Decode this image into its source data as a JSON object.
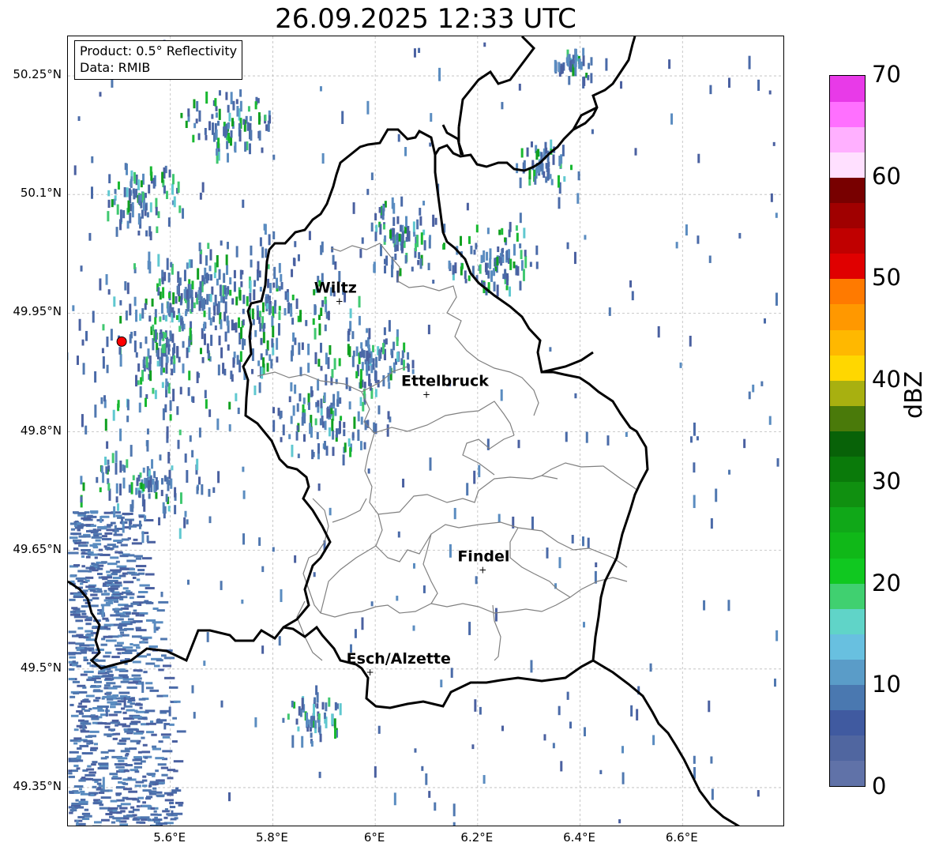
{
  "title": "26.09.2025 12:33 UTC",
  "info": {
    "product": "Product: 0.5° Reflectivity",
    "data": "Data: RMIB"
  },
  "map": {
    "lon_range": [
      5.4,
      6.8
    ],
    "lat_range": [
      49.3,
      50.3
    ],
    "lat_ticks": [
      "50.25°N",
      "50.1°N",
      "49.95°N",
      "49.8°N",
      "49.65°N",
      "49.5°N",
      "49.35°N"
    ],
    "lon_ticks": [
      "5.6°E",
      "5.8°E",
      "6°E",
      "6.2°E",
      "6.4°E",
      "6.6°E"
    ],
    "radar_site": {
      "lon": 5.505,
      "lat": 49.914,
      "color": "#ff0000"
    },
    "cities": [
      {
        "name": "Wiltz",
        "lon": 5.93,
        "lat": 49.966
      },
      {
        "name": "Ettelbruck",
        "lon": 6.1,
        "lat": 49.848
      },
      {
        "name": "Findel",
        "lon": 6.21,
        "lat": 49.626
      },
      {
        "name": "Esch/Alzette",
        "lon": 5.99,
        "lat": 49.497
      }
    ]
  },
  "colorbar": {
    "label": "dBZ",
    "ticks": [
      "70",
      "60",
      "50",
      "40",
      "30",
      "20",
      "10",
      "0"
    ],
    "colors": [
      "#6072a8",
      "#5066a0",
      "#405aa0",
      "#4a78b0",
      "#5a9cc8",
      "#68c0e0",
      "#60d4c8",
      "#40d070",
      "#10c820",
      "#10b818",
      "#10a818",
      "#109010",
      "#0a7a0a",
      "#086208",
      "#4a7a0a",
      "#a8b010",
      "#ffd700",
      "#ffb800",
      "#ff9800",
      "#ff7a00",
      "#e00000",
      "#c00000",
      "#a00000",
      "#780000",
      "#ffe0ff",
      "#ffb0ff",
      "#ff70ff",
      "#e83ae8"
    ]
  }
}
